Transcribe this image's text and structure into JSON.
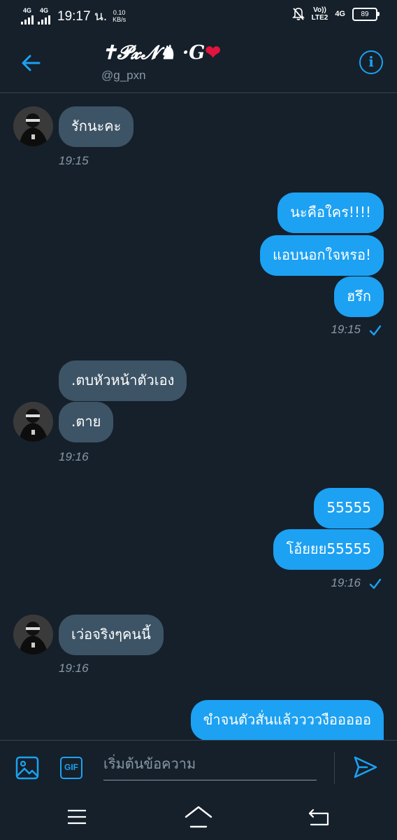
{
  "status_bar": {
    "net1": "4G",
    "net2": "4G",
    "time": "19:17 น.",
    "speed_value": "0.10",
    "speed_unit": "KB/s",
    "volte_top": "Vo))",
    "volte_bottom": "LTE2",
    "net3": "4G",
    "battery": "89"
  },
  "header": {
    "name_prefix": "✝𝓟𝔁𝓝♞ ·G",
    "name_heart": "❤",
    "handle": "@g_pxn"
  },
  "messages": [
    {
      "side": "in",
      "text": "รักนะคะ"
    },
    {
      "side": "in_time",
      "text": "19:15"
    },
    {
      "side": "out",
      "text": "นะคือใคร!!!!"
    },
    {
      "side": "out",
      "text": "แอบนอกใจหรอ!"
    },
    {
      "side": "out",
      "text": "ฮรึก"
    },
    {
      "side": "out_time",
      "text": "19:15"
    },
    {
      "side": "in",
      "text": ".ตบหัวหน้าตัวเอง"
    },
    {
      "side": "in",
      "text": ".ตาย"
    },
    {
      "side": "in_time",
      "text": "19:16"
    },
    {
      "side": "out",
      "text": "55555"
    },
    {
      "side": "out",
      "text": "โอ้ยยย55555"
    },
    {
      "side": "out_time",
      "text": "19:16"
    },
    {
      "side": "in",
      "text": "เว่อจริงๆคนนี้"
    },
    {
      "side": "in_time",
      "text": "19:16"
    },
    {
      "side": "out",
      "text": "ขำจนตัวสั่นแล้ววววงือออออ"
    }
  ],
  "composer": {
    "gif_label": "GIF",
    "placeholder": "เริ่มต้นข้อความ"
  },
  "icons": {
    "back": "arrow-left-icon",
    "info": "info-icon",
    "image": "image-icon",
    "gif": "gif-icon",
    "send": "send-icon",
    "read": "checkmark-icon",
    "mute": "bell-off-icon",
    "nav_menu": "menu-icon",
    "nav_home": "home-icon",
    "nav_back": "return-icon"
  },
  "colors": {
    "background": "#15202b",
    "accent": "#1da1f2",
    "incoming_bubble": "#3d5466",
    "secondary_text": "#8899a6",
    "heart": "#e0143c"
  }
}
